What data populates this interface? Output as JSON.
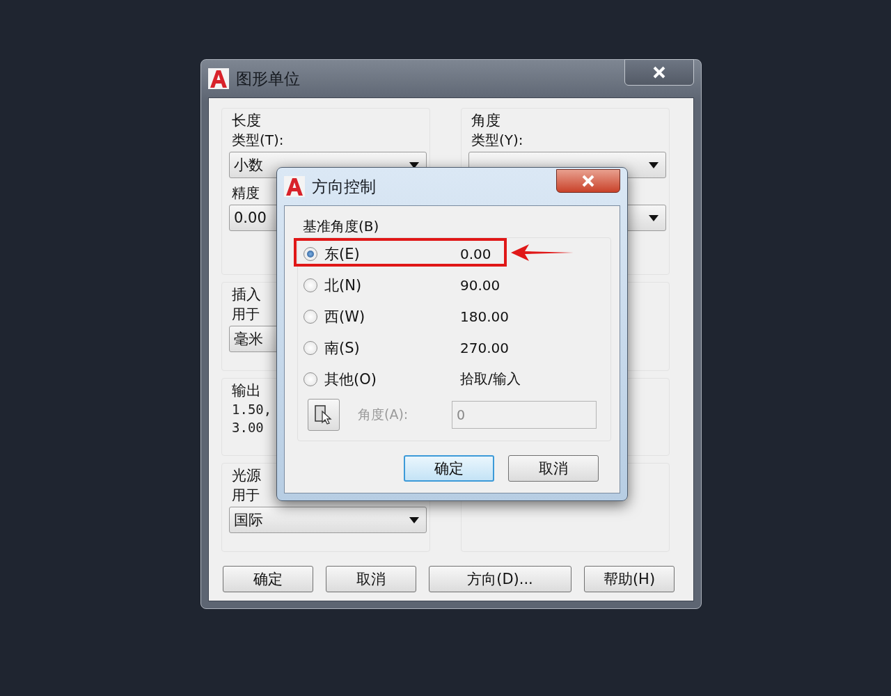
{
  "units_dialog": {
    "title": "图形单位",
    "length": {
      "heading": "长度",
      "type_label": "类型(T):",
      "type_value": "小数",
      "precision_label": "精度",
      "precision_value": "0.00"
    },
    "angle": {
      "heading": "角度",
      "type_label": "类型(Y):"
    },
    "insertion": {
      "heading": "插入",
      "label": "用于",
      "value": "毫米"
    },
    "sample": {
      "heading": "输出",
      "lines": [
        "1.50,",
        "3.00"
      ]
    },
    "lighting": {
      "heading": "光源",
      "label": "用于",
      "value": "国际"
    },
    "buttons": [
      "确定",
      "取消",
      "方向(D)...",
      "帮助(H)"
    ]
  },
  "direction_dialog": {
    "title": "方向控制",
    "group_label": "基准角度(B)",
    "options": [
      {
        "label": "东(E)",
        "value": "0.00",
        "selected": true,
        "highlighted": true
      },
      {
        "label": "北(N)",
        "value": "90.00",
        "selected": false,
        "highlighted": false
      },
      {
        "label": "西(W)",
        "value": "180.00",
        "selected": false,
        "highlighted": false
      },
      {
        "label": "南(S)",
        "value": "270.00",
        "selected": false,
        "highlighted": false
      },
      {
        "label": "其他(O)",
        "value": "拾取/输入",
        "selected": false,
        "highlighted": false
      }
    ],
    "angle_label": "角度(A):",
    "angle_value": "0",
    "angle_disabled": true,
    "buttons": [
      {
        "label": "确定",
        "default": true
      },
      {
        "label": "取消",
        "default": false
      }
    ]
  }
}
